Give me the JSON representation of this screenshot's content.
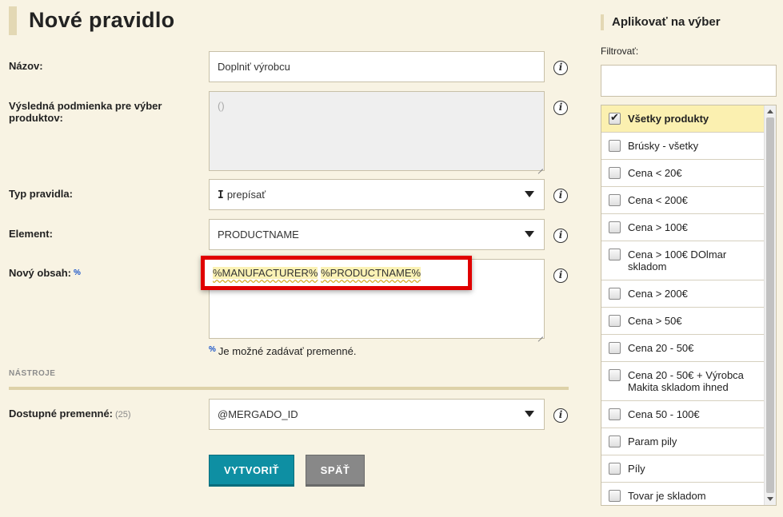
{
  "page": {
    "title": "Nové pravidlo"
  },
  "form": {
    "name": {
      "label": "Názov:",
      "value": "Doplniť výrobcu"
    },
    "condition": {
      "label": "Výsledná podmienka pre výber produktov:",
      "value": "()"
    },
    "rule_type": {
      "label": "Typ pravidla:",
      "value": "prepísať"
    },
    "element": {
      "label": "Element:",
      "value": "PRODUCTNAME"
    },
    "new_content": {
      "label": "Nový obsah:",
      "marker": "%",
      "var1": "%MANUFACTURER%",
      "var2": "%PRODUCTNAME%"
    },
    "hint": {
      "marker": "%",
      "text": "Je možné zadávať premenné."
    }
  },
  "tools": {
    "section_label": "NÁSTROJE",
    "variables_label": "Dostupné premenné:",
    "variables_count": "(25)",
    "variables_value": "@MERGADO_ID"
  },
  "buttons": {
    "create": "VYTVORIŤ",
    "back": "SPÄŤ"
  },
  "right_panel": {
    "title": "Aplikovať na výber",
    "filter_label": "Filtrovať:",
    "items": [
      {
        "label": "Všetky produkty",
        "checked": true
      },
      {
        "label": "Brúsky - všetky",
        "checked": false
      },
      {
        "label": "Cena < 20€",
        "checked": false
      },
      {
        "label": "Cena < 200€",
        "checked": false
      },
      {
        "label": "Cena > 100€",
        "checked": false
      },
      {
        "label": "Cena > 100€ DOlmar skladom",
        "checked": false
      },
      {
        "label": "Cena > 200€",
        "checked": false
      },
      {
        "label": "Cena > 50€",
        "checked": false
      },
      {
        "label": "Cena 20 - 50€",
        "checked": false
      },
      {
        "label": "Cena 20 - 50€ + Výrobca Makita skladom ihned",
        "checked": false
      },
      {
        "label": "Cena 50 - 100€",
        "checked": false
      },
      {
        "label": "Param pily",
        "checked": false
      },
      {
        "label": "Píly",
        "checked": false
      },
      {
        "label": "Tovar je skladom",
        "checked": false
      }
    ]
  },
  "colors": {
    "accent": "#0e8fa3",
    "highlight_border": "#e00000",
    "selected_row": "#fbf0b0"
  }
}
